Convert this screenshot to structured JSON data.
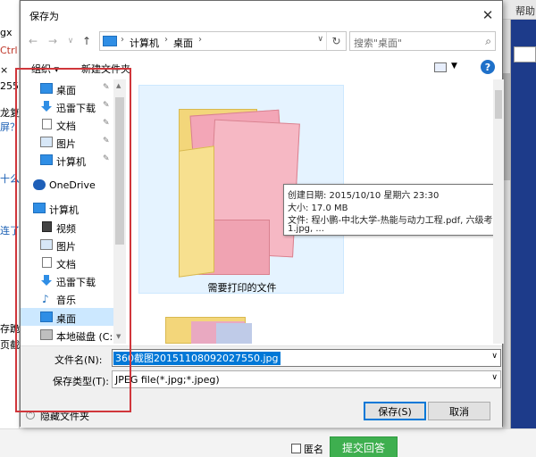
{
  "background": {
    "help_label": "帮助",
    "left_fragments": [
      "gx",
      "Ctrl",
      "×",
      "255",
      "龙复",
      "屏？",
      "十么",
      "连了",
      "存跪",
      "页截"
    ],
    "anonymous_label": "匿名",
    "submit_label": "提交回答"
  },
  "dialog": {
    "title": "保存为",
    "close_glyph": "✕",
    "nav": {
      "back_glyph": "←",
      "forward_glyph": "→",
      "history_glyph": "∨",
      "up_glyph": "↑",
      "breadcrumb": [
        "计算机",
        "桌面"
      ],
      "search_placeholder": "搜索\"桌面\""
    },
    "toolbar": {
      "organize_label": "组织 ▾",
      "new_folder_label": "新建文件夹"
    },
    "nav_pane": {
      "items": [
        {
          "label": "桌面",
          "icon": "desktop-icon",
          "pinned": true
        },
        {
          "label": "迅雷下载",
          "icon": "download-icon",
          "pinned": true
        },
        {
          "label": "文档",
          "icon": "document-icon",
          "pinned": true
        },
        {
          "label": "图片",
          "icon": "picture-icon",
          "pinned": true
        },
        {
          "label": "计算机",
          "icon": "computer-icon",
          "pinned": true
        },
        {
          "label": "OneDrive",
          "icon": "cloud-icon",
          "pinned": false
        },
        {
          "label": "计算机",
          "icon": "computer-icon",
          "pinned": false
        },
        {
          "label": "视频",
          "icon": "video-icon",
          "pinned": false
        },
        {
          "label": "图片",
          "icon": "picture-icon",
          "pinned": false
        },
        {
          "label": "文档",
          "icon": "document-icon",
          "pinned": false
        },
        {
          "label": "迅雷下载",
          "icon": "download-icon",
          "pinned": false
        },
        {
          "label": "音乐",
          "icon": "music-icon",
          "pinned": false
        },
        {
          "label": "桌面",
          "icon": "desktop-icon",
          "pinned": false,
          "selected": true
        },
        {
          "label": "本地磁盘 (C:)",
          "icon": "drive-icon",
          "pinned": false
        }
      ],
      "pin_glyph": "📌"
    },
    "content": {
      "folder_name": "需要打印的文件",
      "tooltip": {
        "created": "创建日期: 2015/10/10 星期六 23:30",
        "size": "大小: 17.0 MB",
        "files": "文件: 程小鹏-中北大学-热能与动力工程.pdf, 六级考试成绩单.p",
        "files_more": "1.jpg, ..."
      }
    },
    "form": {
      "filename_label": "文件名(N):",
      "filename_value": "360截图20151108092027550.jpg",
      "filetype_label": "保存类型(T):",
      "filetype_value": "JPEG file(*.jpg;*.jpeg)",
      "hide_folders_label": "隐藏文件夹",
      "save_label": "保存(S)",
      "cancel_label": "取消"
    }
  },
  "colors": {
    "annotation_red": "#d0363b",
    "selection_blue": "#0078d7",
    "submit_green": "#3eaf4f"
  }
}
